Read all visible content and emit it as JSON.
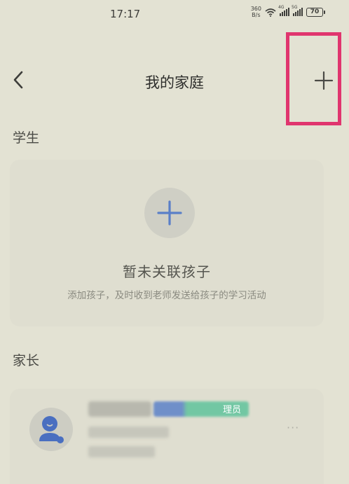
{
  "status_bar": {
    "time": "17:17",
    "net_speed_value": "360",
    "net_speed_unit": "B/s",
    "signal1_tag": "4G",
    "signal2_tag": "5G",
    "battery": "70"
  },
  "header": {
    "title": "我的家庭",
    "back_icon": "chevron-left-icon",
    "add_icon": "plus-icon"
  },
  "students": {
    "section_label": "学生",
    "empty_title": "暂未关联孩子",
    "empty_subtitle": "添加孩子，及时收到老师发送给孩子的学习活动",
    "add_icon": "plus-icon"
  },
  "parents": {
    "section_label": "家长",
    "member": {
      "role_badge": "理员",
      "more_label": "···",
      "avatar_icon": "user-avatar-icon"
    }
  },
  "colors": {
    "background": "#e3e2d3",
    "card": "#dfded0",
    "accent_blue": "#5a7fc8",
    "highlight": "#e0356e",
    "badge_green": "#72c7a3"
  }
}
